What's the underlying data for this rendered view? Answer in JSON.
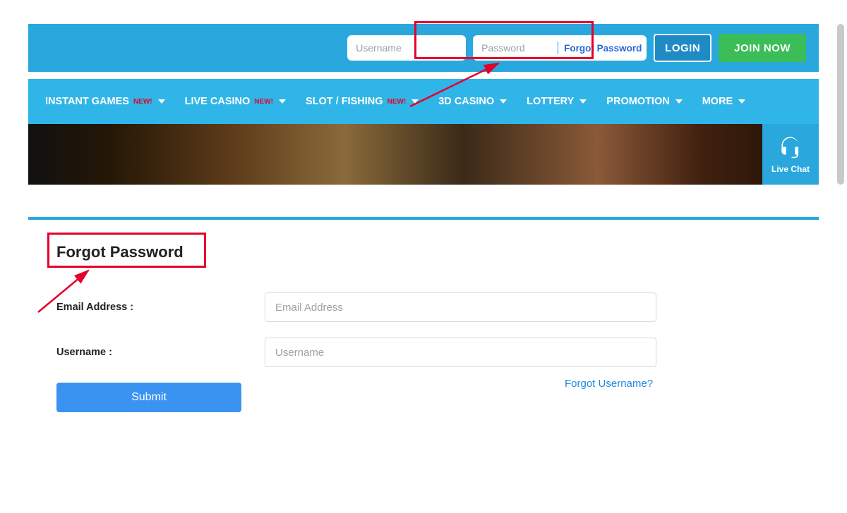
{
  "topbar": {
    "username_placeholder": "Username",
    "password_placeholder": "Password",
    "forgot_password": "Forgot Password",
    "login": "LOGIN",
    "join": "JOIN NOW"
  },
  "nav": {
    "new_badge": "NEW!",
    "items": [
      {
        "label": "INSTANT GAMES",
        "new": true
      },
      {
        "label": "LIVE CASINO",
        "new": true
      },
      {
        "label": "SLOT / FISHING",
        "new": true
      },
      {
        "label": "3D CASINO",
        "new": false
      },
      {
        "label": "LOTTERY",
        "new": false
      },
      {
        "label": "PROMOTION",
        "new": false
      },
      {
        "label": "MORE",
        "new": false
      }
    ]
  },
  "live_chat": "Live Chat",
  "section_title": "Forgot Password",
  "form": {
    "email_label": "Email Address :",
    "email_placeholder": "Email Address",
    "username_label": "Username :",
    "username_placeholder": "Username",
    "submit": "Submit",
    "forgot_username": "Forgot Username?"
  }
}
